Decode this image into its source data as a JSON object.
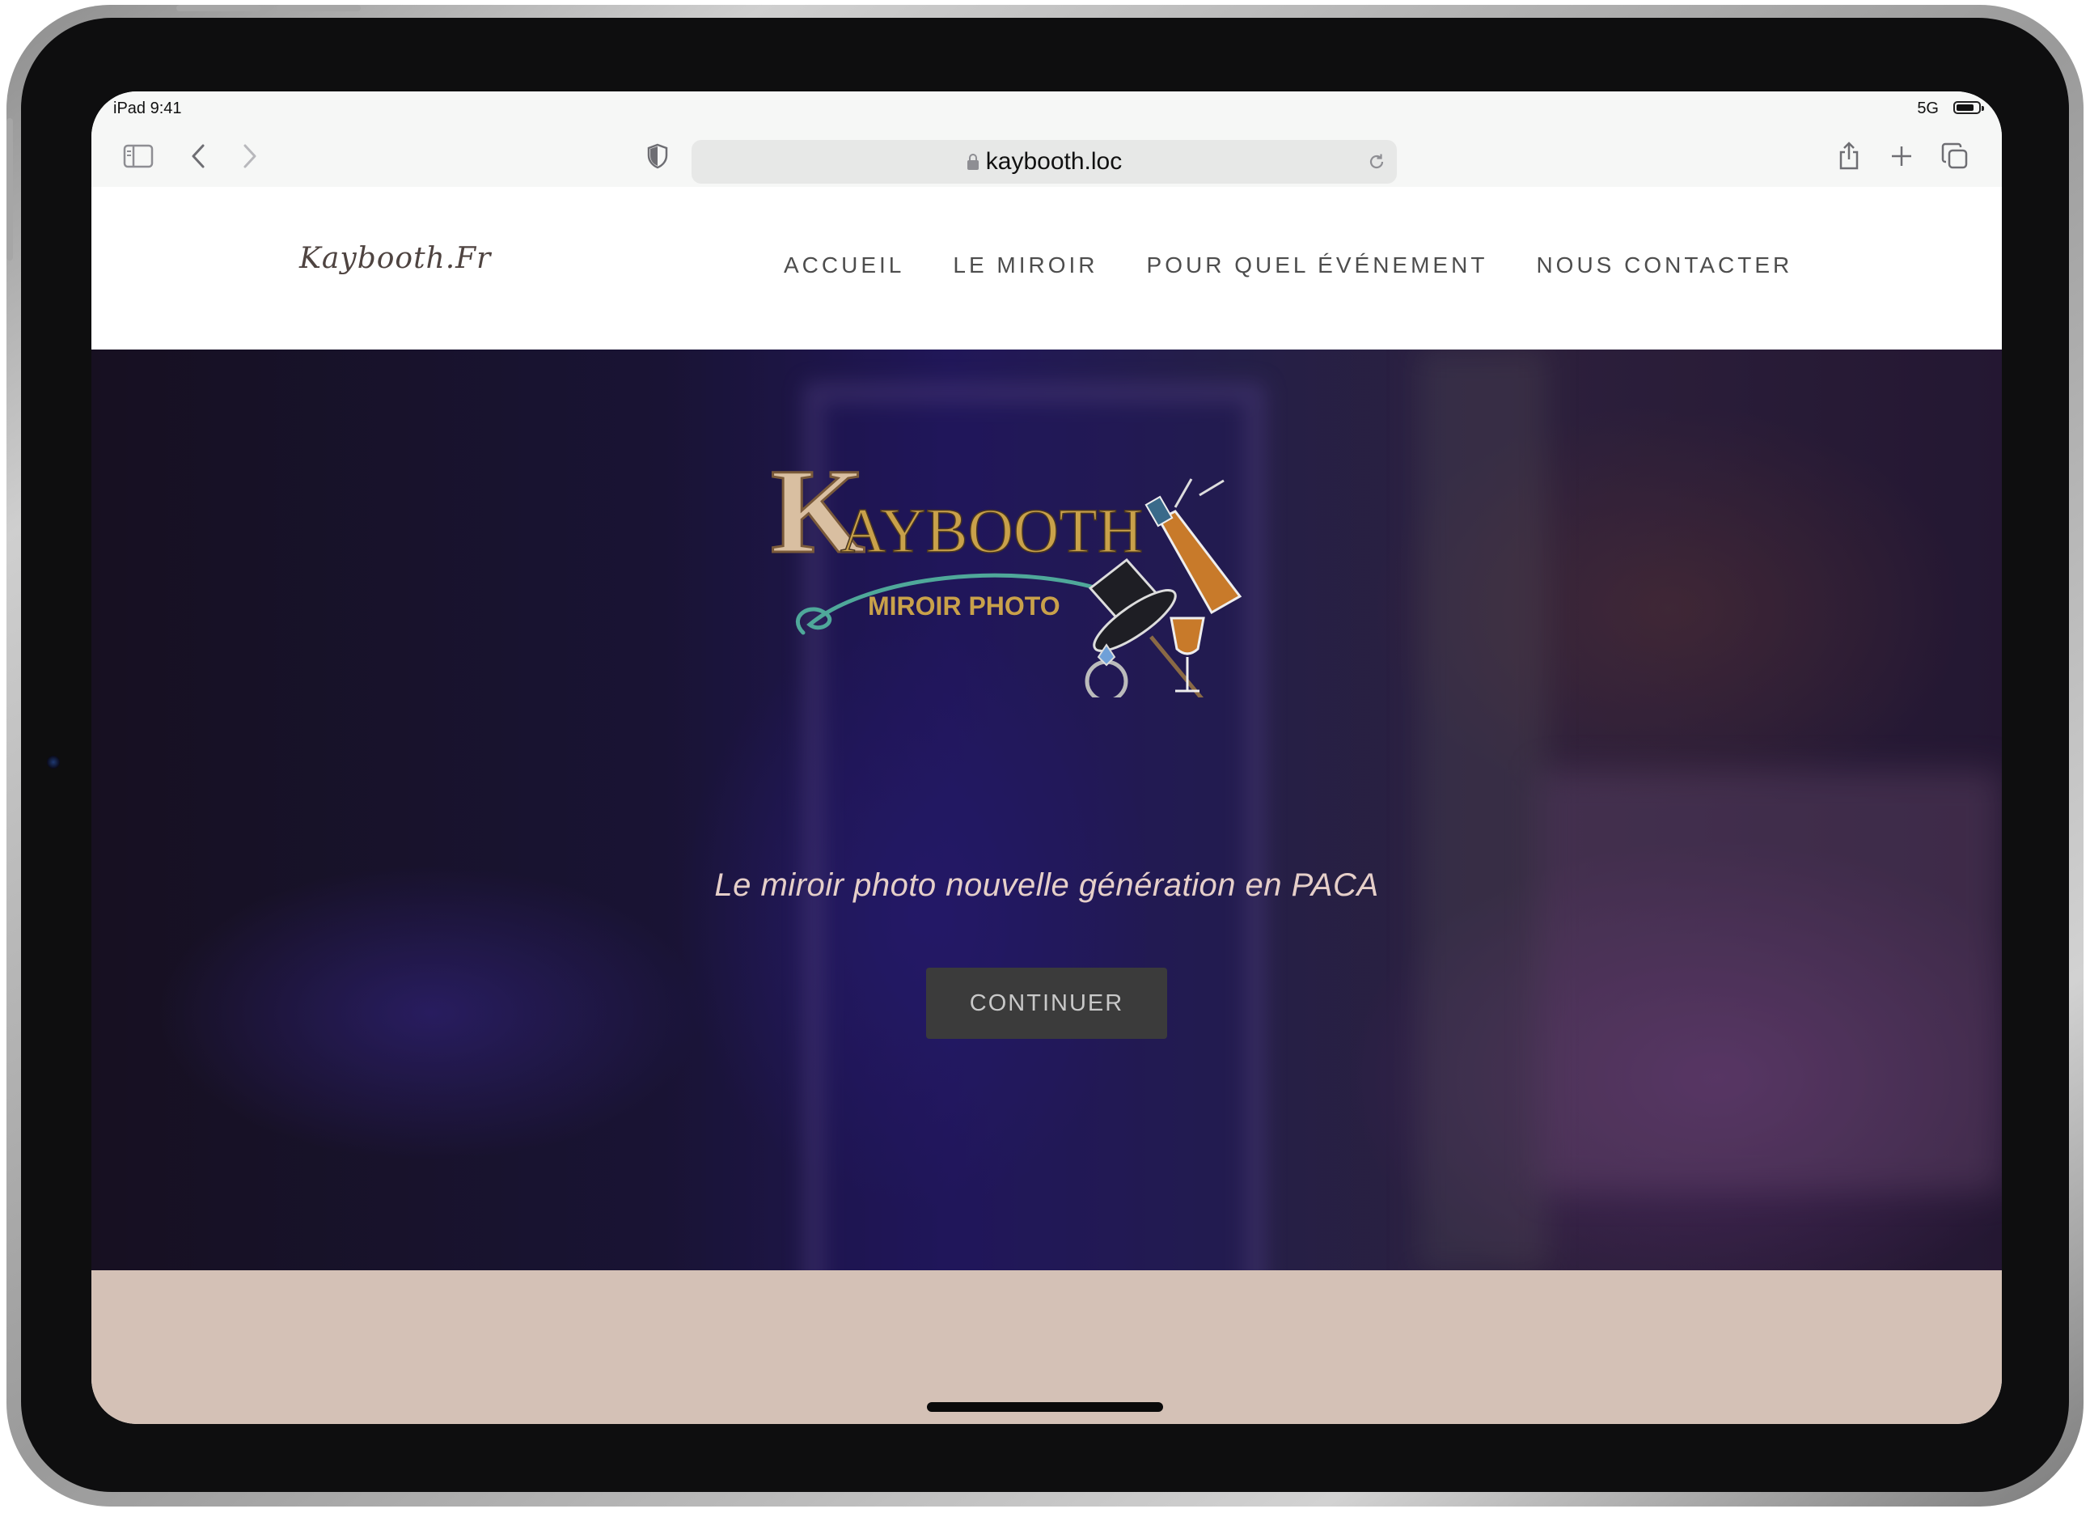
{
  "status_bar": {
    "time": "iPad 9:41",
    "network": "5G",
    "battery_level": 0.85
  },
  "browser": {
    "url": "kaybooth.loc",
    "icons": {
      "sidebar": "sidebar-icon",
      "back": "chevron-left-icon",
      "forward": "chevron-right-icon",
      "privacy": "shield-icon",
      "lock": "lock-icon",
      "reload": "reload-icon",
      "share": "share-icon",
      "new_tab": "plus-icon",
      "tabs": "tabs-overview-icon"
    }
  },
  "site": {
    "brand": "Kaybooth.Fr",
    "nav": [
      "ACCUEIL",
      "LE MIROIR",
      "POUR QUEL ÉVÉNEMENT",
      "NOUS CONTACTER"
    ]
  },
  "hero": {
    "logo_title": "KAYBOOTH",
    "logo_subtitle": "MIROIR PHOTO",
    "tagline": "Le miroir photo nouvelle génération en PACA",
    "button": "CONTINUER"
  },
  "colors": {
    "nav_text": "#4d4d4d",
    "brand_text": "#4e4340",
    "tagline": "#e6cfc9",
    "button_bg": "#3b3b3b",
    "section_bg": "#d4c1b6",
    "logo_gold": "#c9a14a",
    "logo_teal": "#4fa89a"
  }
}
